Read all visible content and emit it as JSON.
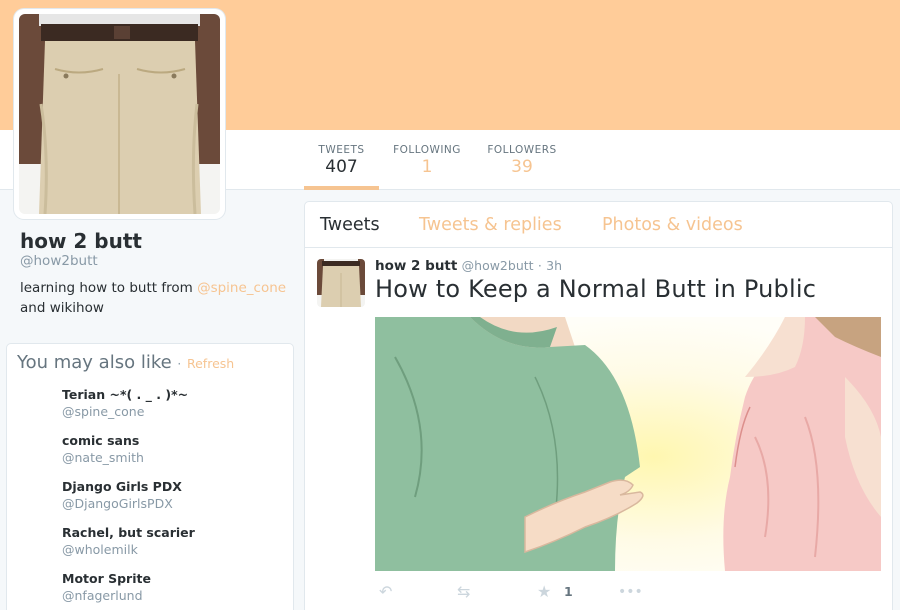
{
  "theme": {
    "banner_color": "#ffcc99",
    "accent_color": "#f6c491"
  },
  "profile": {
    "name": "how 2 butt",
    "handle": "@how2butt",
    "bio_before": "learning how to butt from ",
    "bio_mention": "@spine_cone",
    "bio_after": " and wikihow",
    "avatar_icon": "khaki-pants-photo"
  },
  "stats": [
    {
      "label": "TWEETS",
      "value": "407"
    },
    {
      "label": "FOLLOWING",
      "value": "1"
    },
    {
      "label": "FOLLOWERS",
      "value": "39"
    }
  ],
  "who_to_follow": {
    "title": "You may also like",
    "separator": "·",
    "refresh_label": "Refresh",
    "users": [
      {
        "name": "Terian ~*( . _ . )*~",
        "handle": "@spine_cone"
      },
      {
        "name": "comic sans",
        "handle": "@nate_smith"
      },
      {
        "name": "Django Girls PDX",
        "handle": "@DjangoGirlsPDX"
      },
      {
        "name": "Rachel, but scarier",
        "handle": "@wholemilk"
      },
      {
        "name": "Motor Sprite",
        "handle": "@nfagerlund"
      }
    ]
  },
  "timeline": {
    "tabs": [
      "Tweets",
      "Tweets & replies",
      "Photos & videos"
    ],
    "tweet": {
      "author": "how 2 butt",
      "handle": "@how2butt",
      "separator": "·",
      "time": "3h",
      "text": "How to Keep a Normal Butt in Public",
      "media_icon": "wikihow-illustration",
      "favorite_count": "1",
      "actions": [
        "reply-icon",
        "retweet-icon",
        "favorite-icon",
        "more-icon"
      ]
    }
  }
}
